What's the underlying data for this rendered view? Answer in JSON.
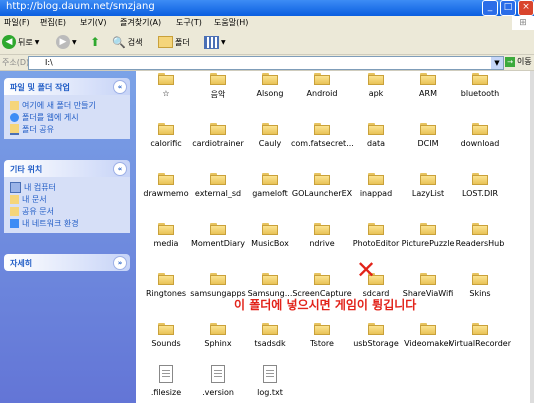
{
  "window": {
    "title": "http://blog.daum.net/smzjang"
  },
  "menu": {
    "items": [
      "파일(F)",
      "편집(E)",
      "보기(V)",
      "즐겨찾기(A)",
      "도구(T)",
      "도움말(H)"
    ]
  },
  "toolbar": {
    "back_label": "뒤로",
    "search_label": "검색",
    "folders_label": "폴더"
  },
  "address": {
    "label": "주소(D)",
    "value": "I:\\",
    "go_label": "이동"
  },
  "sidebar": {
    "tasks": {
      "title": "파일 및 폴더 작업",
      "items": [
        "여기에 새 폴더 만들기",
        "폴더를 웹에 게시",
        "폴더 공유"
      ]
    },
    "other": {
      "title": "기타 위치",
      "items": [
        "내 컴퓨터",
        "내 문서",
        "공유 문서",
        "내 네트워크 환경"
      ]
    },
    "details": {
      "title": "자세히"
    }
  },
  "folders": [
    "☆",
    "음악",
    "Alsong",
    "Android",
    "apk",
    "ARM",
    "bluetooth",
    "calorific",
    "cardiotrainer",
    "Cauly",
    "com.fatsecret...",
    "data",
    "DCIM",
    "download",
    "drawmemo",
    "external_sd",
    "gameloft",
    "GOLauncherEX",
    "inappad",
    "LazyList",
    "LOST.DIR",
    "media",
    "MomentDiary",
    "MusicBox",
    "ndrive",
    "PhotoEditor",
    "PicturePuzzle",
    "ReadersHub",
    "Ringtones",
    "samsungapps",
    "Samsung...",
    "ScreenCapture",
    "sdcard",
    "ShareViaWifi",
    "Skins",
    "Sounds",
    "Sphinx",
    "tsadsdk",
    "Tstore",
    "usbStorage",
    "Videomaker",
    "VirtualRecorder"
  ],
  "files": [
    ".filesize",
    ".version",
    "log.txt"
  ],
  "annotation": {
    "text": "이 폴더에 넣으시면 게임이 튕깁니다"
  },
  "colors": {
    "sidebar_bg": "#6f8ee0",
    "folder": "#f5d57a",
    "annotation": "#e2231a"
  }
}
